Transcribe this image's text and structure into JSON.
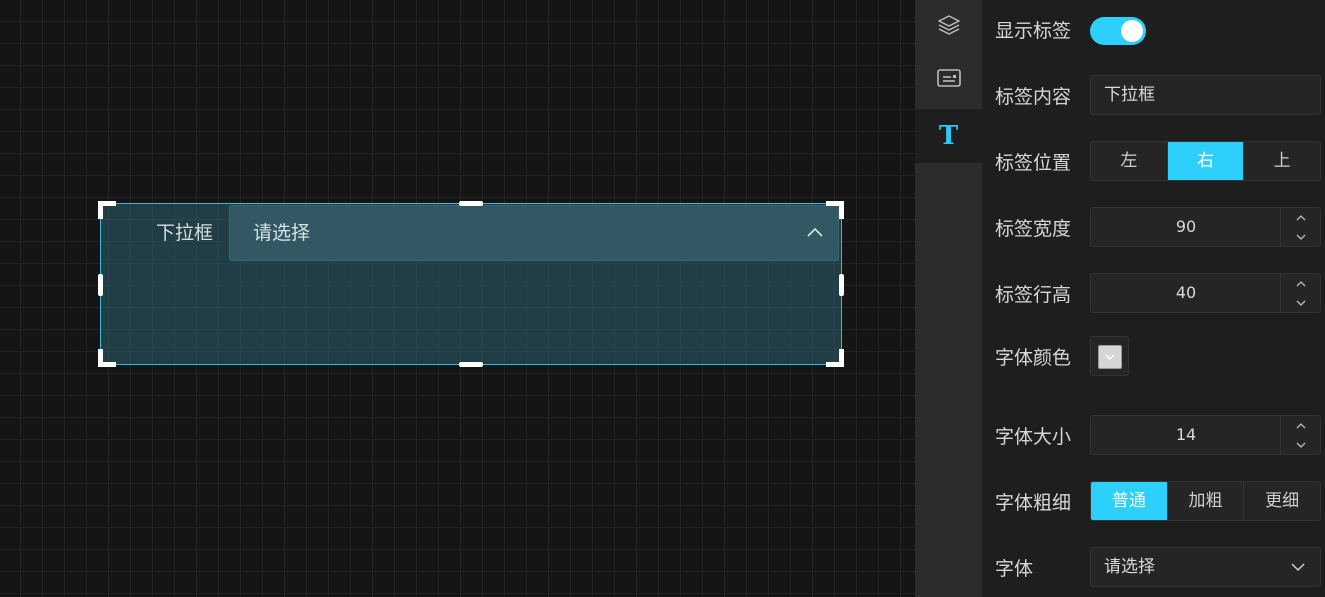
{
  "canvas": {
    "widget": {
      "label": "下拉框",
      "placeholder": "请选择",
      "label_position": "右",
      "accent_color": "#2bbde0"
    }
  },
  "rail": {
    "items": [
      {
        "name": "layers-icon",
        "active": false
      },
      {
        "name": "card-icon",
        "active": false
      },
      {
        "name": "text-icon",
        "glyph": "T",
        "active": true
      }
    ]
  },
  "panel": {
    "show_label": {
      "label": "显示标签",
      "on": true
    },
    "label_content": {
      "label": "标签内容",
      "value": "下拉框"
    },
    "label_position": {
      "label": "标签位置",
      "options": [
        "左",
        "右",
        "上"
      ],
      "selected": "右"
    },
    "label_width": {
      "label": "标签宽度",
      "value": "90"
    },
    "label_line_height": {
      "label": "标签行高",
      "value": "40"
    },
    "font_color": {
      "label": "字体颜色",
      "value": "#d6d6d6"
    },
    "font_size": {
      "label": "字体大小",
      "value": "14"
    },
    "font_weight": {
      "label": "字体粗细",
      "options": [
        "普通",
        "加粗",
        "更细"
      ],
      "selected": "普通"
    },
    "font_family": {
      "label": "字体",
      "placeholder": "请选择"
    }
  },
  "colors": {
    "accent": "#2dd0fa",
    "panel_bg": "#1e1e1e",
    "rail_bg": "#2c2c2c",
    "canvas_bg": "#151515"
  }
}
